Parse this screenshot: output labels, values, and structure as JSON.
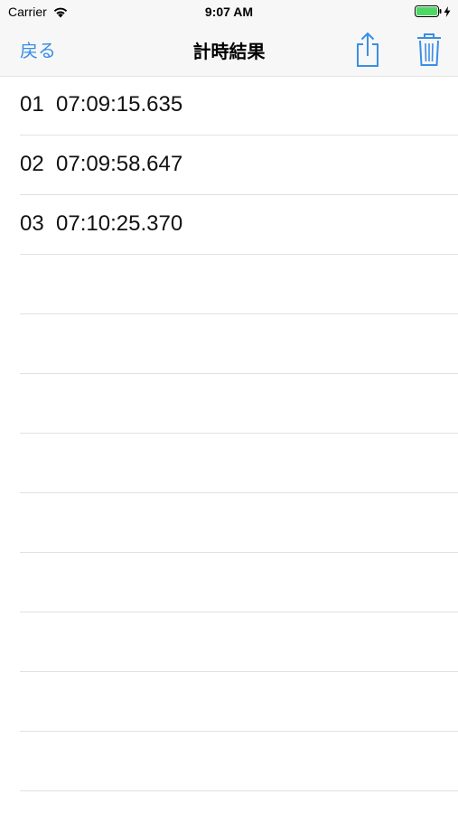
{
  "status_bar": {
    "carrier": "Carrier",
    "time": "9:07 AM"
  },
  "nav": {
    "back_label": "戻る",
    "title": "計時結果"
  },
  "results": [
    {
      "text": "01  07:09:15.635"
    },
    {
      "text": "02  07:09:58.647"
    },
    {
      "text": "03  07:10:25.370"
    },
    {
      "text": ""
    },
    {
      "text": ""
    },
    {
      "text": ""
    },
    {
      "text": ""
    },
    {
      "text": ""
    },
    {
      "text": ""
    },
    {
      "text": ""
    },
    {
      "text": ""
    },
    {
      "text": ""
    }
  ],
  "colors": {
    "accent": "#3a8ee6",
    "battery": "#4cd964"
  },
  "icons": {
    "share": "share-icon",
    "trash": "trash-icon",
    "wifi": "wifi-icon",
    "battery": "battery-icon",
    "charging": "charging-bolt-icon"
  }
}
